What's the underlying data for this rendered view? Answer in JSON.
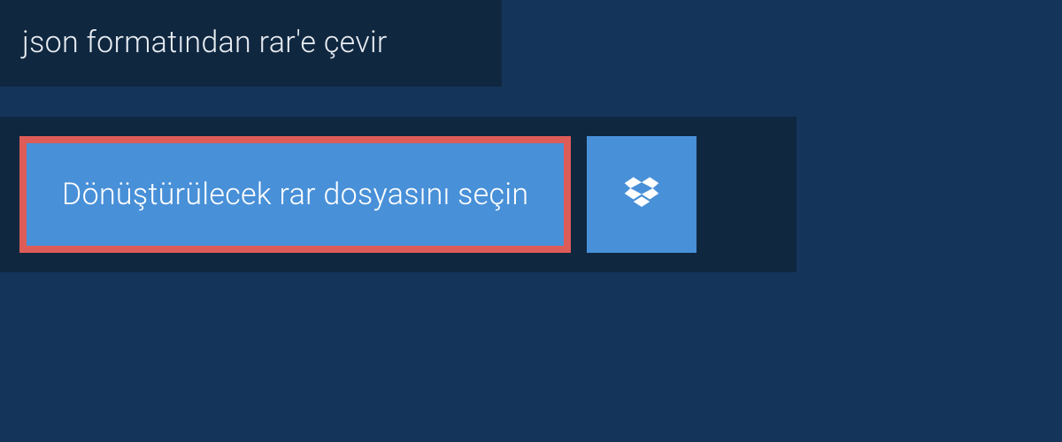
{
  "header": {
    "title": "json formatından rar'e çevir"
  },
  "buttons": {
    "fileSelect": "Dönüştürülecek rar dosyasını seçin"
  },
  "colors": {
    "background": "#15345a",
    "panelBackground": "#102740",
    "buttonBlue": "#4890d8",
    "highlightBorder": "#de5c58",
    "textLight": "#e8edf2"
  }
}
